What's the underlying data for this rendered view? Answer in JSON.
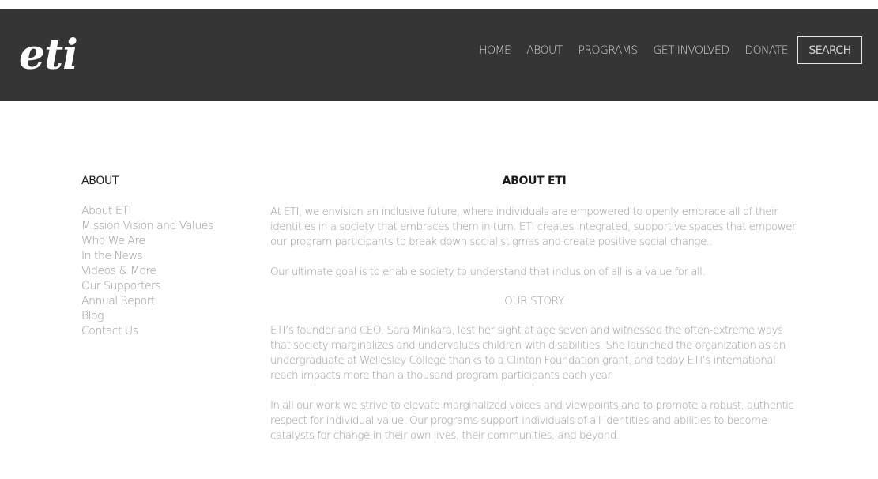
{
  "header": {
    "logo_text": "eti",
    "nav": {
      "home": "HOME",
      "about": "ABOUT",
      "programs": "PROGRAMS",
      "get_involved": "GET INVOLVED",
      "donate": "DONATE",
      "search": "SEARCH"
    }
  },
  "sidebar": {
    "title": "ABOUT",
    "links": [
      "About ETI",
      "Mission Vision and Values",
      "Who We Are",
      "In the News",
      "Videos & More",
      "Our Supporters",
      "Annual Report",
      "Blog",
      "Contact Us"
    ]
  },
  "main": {
    "title": "ABOUT ETI",
    "intro_p1": "At ETI, we envision an inclusive future, where individuals are empowered to openly embrace all of their identities in a society that embraces them in turn. ETI creates integrated, supportive spaces that empower our program participants to break down social stigmas and create positive social change..",
    "intro_p2": "Our ultimate goal is to enable society to understand that inclusion of all is a value for all.",
    "story_heading": "OUR STORY",
    "story_p1": "ETI’s founder and CEO, Sara Minkara, lost her sight at age seven and witnessed the often-extreme ways that society marginalizes and undervalues children with disabilities. She launched the organization as an undergraduate at Wellesley College thanks to a Clinton Foundation grant, and today ETI’s international reach impacts more than a thousand program participants each year.",
    "story_p2": "In all our work we strive to elevate marginalized voices and viewpoints and to promote a robust, authentic respect for individual value. Our programs support individuals of all identities and abilities to become catalysts for change in their own lives, their communities, and beyond."
  },
  "colors": {
    "header_bg": "#353535",
    "nav_text": "#d2d2d2",
    "heading_text": "#1a1a1a",
    "body_text": "#9a9a9a",
    "page_bg": "#ffffff"
  }
}
